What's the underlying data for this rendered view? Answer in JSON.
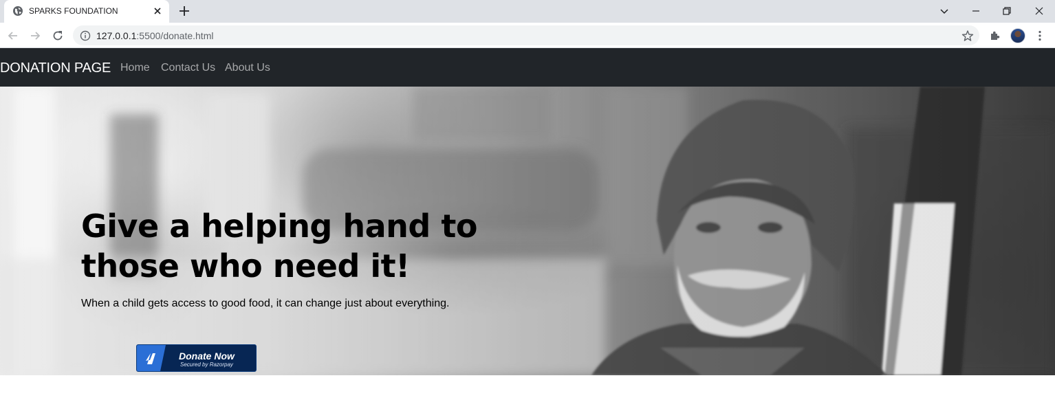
{
  "browser": {
    "tab_title": "SPARKS FOUNDATION",
    "url_host": "127.0.0.1",
    "url_path": ":5500/donate.html"
  },
  "site": {
    "brand": "DONATION PAGE",
    "nav_links": [
      "Home",
      "Contact Us",
      "About Us"
    ]
  },
  "hero": {
    "headline_line1": "Give a helping hand to",
    "headline_line2": "those who need it!",
    "tagline": "When a child gets access to good food, it can change just about everything.",
    "donate_label": "Donate Now",
    "donate_sublabel": "Secured by Razorpay"
  },
  "colors": {
    "navbar_bg": "#212529",
    "donate_bg": "#072654",
    "donate_accent": "#2b6fd6"
  }
}
